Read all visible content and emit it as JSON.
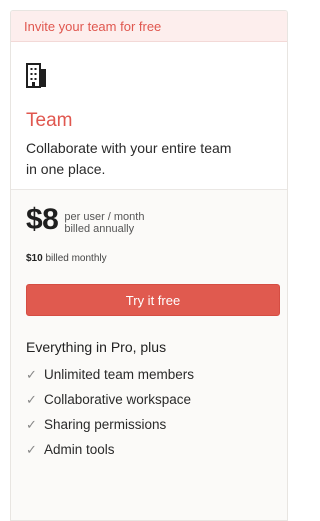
{
  "banner": {
    "text": "Invite your team for free"
  },
  "plan": {
    "icon": "building-icon",
    "name": "Team",
    "description": "Collaborate with your entire team in one place."
  },
  "pricing": {
    "price": "$8",
    "unit_line1": "per user / month",
    "unit_line2": "billed annually",
    "monthly_amount": "$10",
    "monthly_label": "billed monthly"
  },
  "cta": {
    "label": "Try it free"
  },
  "features": {
    "title": "Everything in Pro, plus",
    "items": [
      "Unlimited team members",
      "Collaborative workspace",
      "Sharing permissions",
      "Admin tools"
    ]
  },
  "colors": {
    "accent": "#e0574f",
    "banner_bg": "#fdeeed",
    "card_bg": "#fbfaf8"
  }
}
